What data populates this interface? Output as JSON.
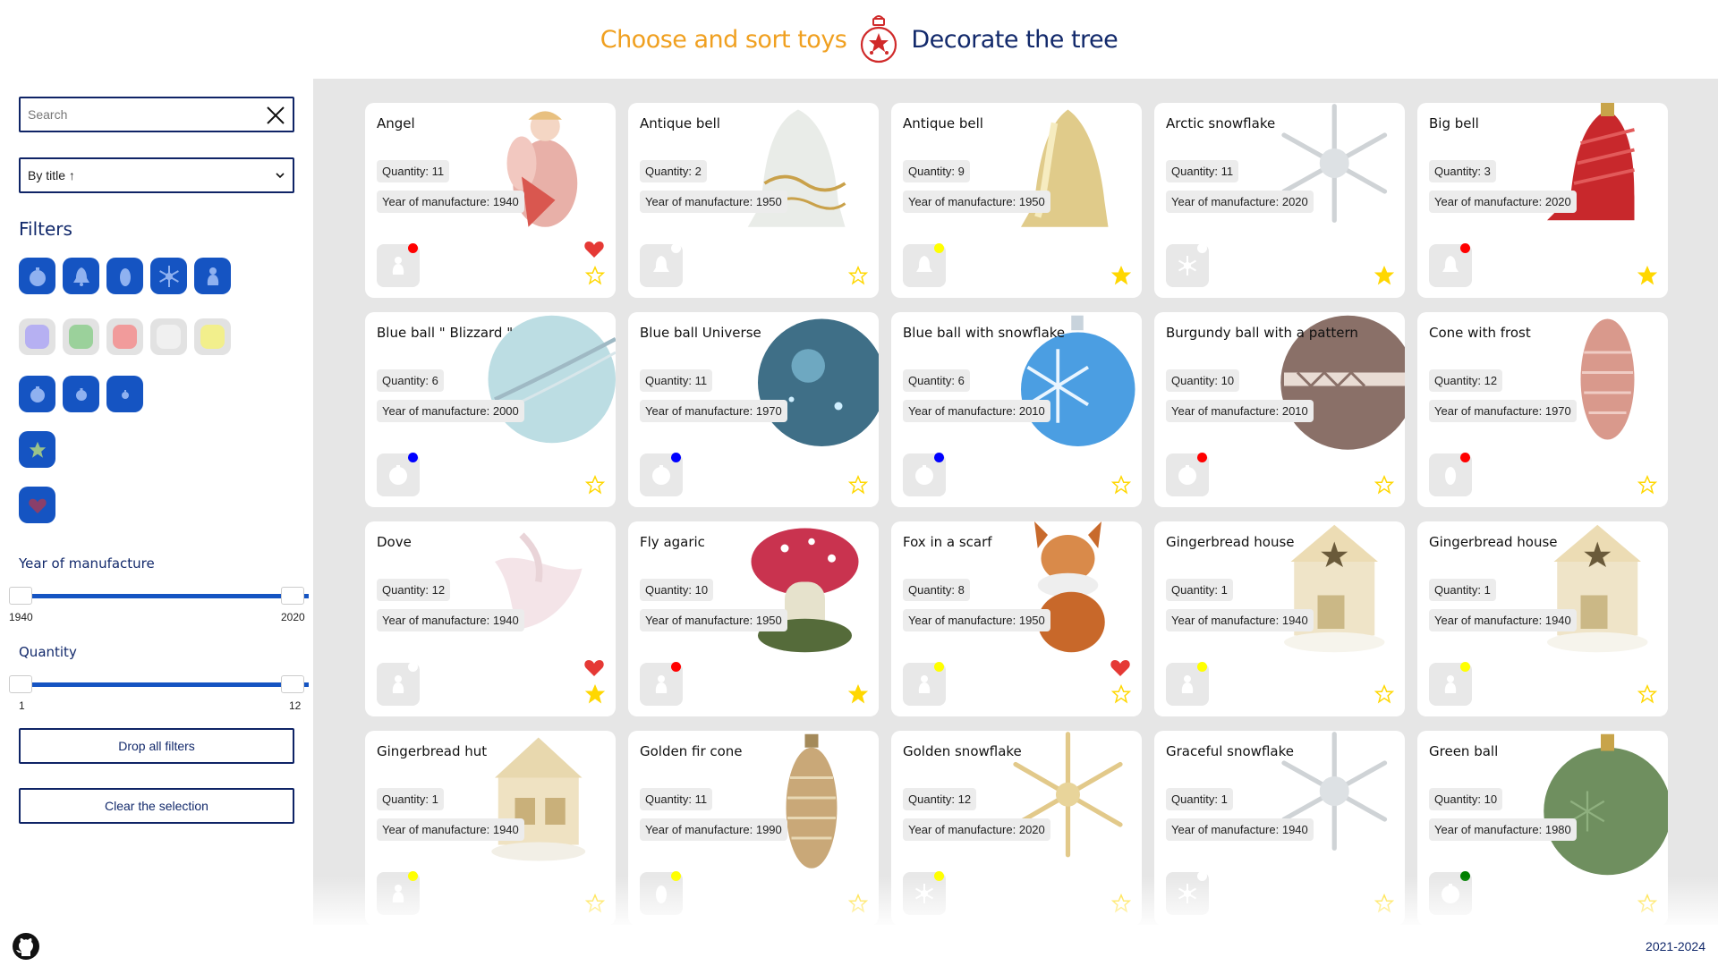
{
  "header": {
    "nav_toys": "Choose and sort toys",
    "nav_tree": "Decorate the tree",
    "logo": "ornament-logo"
  },
  "sidebar": {
    "search_placeholder": "Search",
    "sort": "By title ↑",
    "filters_title": "Filters",
    "shapes": [
      "ball-icon",
      "bell-icon",
      "cone-icon",
      "snowflake-icon",
      "figure-icon"
    ],
    "colors": [
      "#b6b0f2",
      "#9bd19b",
      "#f19b9b",
      "#f0f0f0",
      "#f2ef8c"
    ],
    "sizes": [
      "large",
      "medium",
      "small"
    ],
    "year_label": "Year of manufacture",
    "year_min": "1940",
    "year_max": "2020",
    "qty_label": "Quantity",
    "qty_min": "1",
    "qty_max": "12",
    "drop_label": "Drop all filters",
    "clear_label": "Clear the selection"
  },
  "footer": {
    "years": "2021-2024",
    "github": "github-icon"
  },
  "card_labels": {
    "qty": "Quantity:",
    "year": "Year of manufacture:"
  },
  "toys": [
    {
      "title": "Angel",
      "qty": "11",
      "year": "1940",
      "shape": "figure",
      "dot": "#ff0000",
      "fav": true,
      "star": false,
      "img": "angel"
    },
    {
      "title": "Antique bell",
      "qty": "2",
      "year": "1950",
      "shape": "bell",
      "dot": "#ffffff",
      "fav": false,
      "star": false,
      "img": "bell-white"
    },
    {
      "title": "Antique bell",
      "qty": "9",
      "year": "1950",
      "shape": "bell",
      "dot": "#ffff00",
      "fav": false,
      "star": true,
      "img": "bell-gold"
    },
    {
      "title": "Arctic snowflake",
      "qty": "11",
      "year": "2020",
      "shape": "snowflake",
      "dot": "#ffffff",
      "fav": false,
      "star": true,
      "img": "snow-white"
    },
    {
      "title": "Big bell",
      "qty": "3",
      "year": "2020",
      "shape": "bell",
      "dot": "#ff0000",
      "fav": false,
      "star": true,
      "img": "bell-red"
    },
    {
      "title": "Blue ball \" Blizzard \"",
      "qty": "6",
      "year": "2000",
      "shape": "ball",
      "dot": "#0000ff",
      "fav": false,
      "star": false,
      "img": "ball-lightblue"
    },
    {
      "title": "Blue ball Universe",
      "qty": "11",
      "year": "1970",
      "shape": "ball",
      "dot": "#0000ff",
      "fav": false,
      "star": false,
      "img": "ball-universe"
    },
    {
      "title": "Blue ball with snowflake",
      "qty": "6",
      "year": "2010",
      "shape": "ball",
      "dot": "#0000ff",
      "fav": false,
      "star": false,
      "img": "ball-snow"
    },
    {
      "title": "Burgundy ball with a pattern",
      "qty": "10",
      "year": "2010",
      "shape": "ball",
      "dot": "#ff0000",
      "fav": false,
      "star": false,
      "img": "ball-burgundy"
    },
    {
      "title": "Cone with frost",
      "qty": "12",
      "year": "1970",
      "shape": "cone",
      "dot": "#ff0000",
      "fav": false,
      "star": false,
      "img": "cone-pink"
    },
    {
      "title": "Dove",
      "qty": "12",
      "year": "1940",
      "shape": "figure",
      "dot": "#ffffff",
      "fav": true,
      "star": true,
      "img": "dove"
    },
    {
      "title": "Fly agaric",
      "qty": "10",
      "year": "1950",
      "shape": "figure",
      "dot": "#ff0000",
      "fav": false,
      "star": true,
      "img": "mushroom"
    },
    {
      "title": "Fox in a scarf",
      "qty": "8",
      "year": "1950",
      "shape": "figure",
      "dot": "#ffff00",
      "fav": true,
      "star": false,
      "img": "fox"
    },
    {
      "title": "Gingerbread house",
      "qty": "1",
      "year": "1940",
      "shape": "figure",
      "dot": "#ffff00",
      "fav": false,
      "star": false,
      "img": "house"
    },
    {
      "title": "Gingerbread house",
      "qty": "1",
      "year": "1940",
      "shape": "figure",
      "dot": "#ffff00",
      "fav": false,
      "star": false,
      "img": "house"
    },
    {
      "title": "Gingerbread hut",
      "qty": "1",
      "year": "1940",
      "shape": "figure",
      "dot": "#ffff00",
      "fav": false,
      "star": false,
      "img": "hut"
    },
    {
      "title": "Golden fir cone",
      "qty": "11",
      "year": "1990",
      "shape": "cone",
      "dot": "#ffff00",
      "fav": false,
      "star": false,
      "img": "cone-gold"
    },
    {
      "title": "Golden snowflake",
      "qty": "12",
      "year": "2020",
      "shape": "snowflake",
      "dot": "#ffff00",
      "fav": false,
      "star": false,
      "img": "snow-gold"
    },
    {
      "title": "Graceful snowflake",
      "qty": "1",
      "year": "1940",
      "shape": "snowflake",
      "dot": "#ffffff",
      "fav": false,
      "star": false,
      "img": "snow-white"
    },
    {
      "title": "Green ball",
      "qty": "10",
      "year": "1980",
      "shape": "ball",
      "dot": "#008000",
      "fav": false,
      "star": false,
      "img": "ball-green"
    }
  ]
}
